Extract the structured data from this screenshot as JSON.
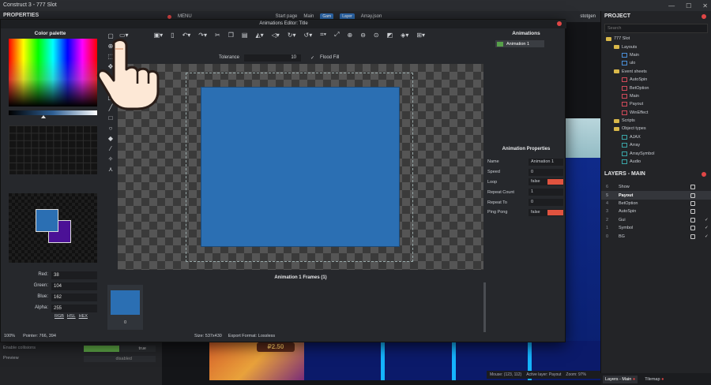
{
  "window": {
    "title": "Construct 3 - 777 Slot"
  },
  "topbar": {
    "menu": "MENU",
    "items": [
      "Start page",
      "Main",
      "Gam",
      "Layer",
      "Array.json"
    ],
    "user": "stotgen"
  },
  "properties": {
    "title": "PROPERTIES",
    "rows": [
      {
        "label": "Enable collisions",
        "value": "true"
      },
      {
        "label": "Preview",
        "value": "disabled"
      }
    ]
  },
  "dialog": {
    "title": "Animations Editor: Title",
    "color_palette": {
      "title": "Color palette",
      "primary": "#2b6fb3",
      "secondary": "#4b1196",
      "rgba": [
        {
          "label": "Red:",
          "value": "38"
        },
        {
          "label": "Green:",
          "value": "104"
        },
        {
          "label": "Blue:",
          "value": "162"
        },
        {
          "label": "Alpha:",
          "value": "255"
        }
      ],
      "modes": [
        "RGB",
        "HSL",
        "HEX"
      ]
    },
    "options": {
      "tolerance_label": "Tolerance",
      "tolerance_value": "10",
      "flood_fill_label": "Flood Fill",
      "flood_fill_checked": "✓"
    },
    "frames": {
      "title": "Animation 1 Frames (1)",
      "items": [
        {
          "index": "0",
          "color": "#2b6fb3"
        }
      ]
    },
    "status": {
      "zoom": "100%",
      "pointer": "Pointer: 766, 394",
      "size": "Size: 537x430",
      "format": "Export Format: Lossless"
    },
    "animations": {
      "title": "Animations",
      "items": [
        {
          "name": "Animation 1",
          "color": "#57a04a"
        }
      ]
    },
    "anim_props": {
      "title": "Animation Properties",
      "rows": [
        {
          "label": "Name",
          "value": "Animation 1"
        },
        {
          "label": "Speed",
          "value": "0"
        },
        {
          "label": "Loop",
          "value": "false"
        },
        {
          "label": "Repeat Count",
          "value": "1"
        },
        {
          "label": "Repeat To",
          "value": "0"
        },
        {
          "label": "Ping Pong",
          "value": "false"
        }
      ]
    }
  },
  "project": {
    "title": "PROJECT",
    "search_placeholder": "Search",
    "tree": [
      {
        "label": "777 Slot",
        "type": "folder",
        "indent": 0
      },
      {
        "label": "Layouts",
        "type": "folder",
        "indent": 1
      },
      {
        "label": "Main",
        "type": "layout",
        "indent": 2
      },
      {
        "label": "ulo",
        "type": "layout",
        "indent": 2
      },
      {
        "label": "Event sheets",
        "type": "folder",
        "indent": 1
      },
      {
        "label": "AutoSpin",
        "type": "event",
        "indent": 2
      },
      {
        "label": "BetOption",
        "type": "event",
        "indent": 2
      },
      {
        "label": "Main",
        "type": "event",
        "indent": 2
      },
      {
        "label": "Payout",
        "type": "event",
        "indent": 2
      },
      {
        "label": "WinEffect",
        "type": "event",
        "indent": 2
      },
      {
        "label": "Scripts",
        "type": "folder",
        "indent": 1
      },
      {
        "label": "Object types",
        "type": "folder",
        "indent": 1
      },
      {
        "label": "AJAX",
        "type": "object",
        "indent": 2
      },
      {
        "label": "Array",
        "type": "object",
        "indent": 2
      },
      {
        "label": "ArraySymbol",
        "type": "object",
        "indent": 2
      },
      {
        "label": "Audio",
        "type": "object",
        "indent": 2
      }
    ]
  },
  "layers": {
    "title": "LAYERS - MAIN",
    "rows": [
      {
        "num": "6",
        "name": "Show",
        "check": ""
      },
      {
        "num": "5",
        "name": "Payout",
        "check": "",
        "selected": true
      },
      {
        "num": "4",
        "name": "BetOption",
        "check": ""
      },
      {
        "num": "3",
        "name": "AutoSpin",
        "check": ""
      },
      {
        "num": "2",
        "name": "Gui",
        "check": "✓"
      },
      {
        "num": "1",
        "name": "Symbol",
        "check": "✓"
      },
      {
        "num": "0",
        "name": "BG",
        "check": "✓"
      }
    ],
    "tabs": [
      "Layers - Main",
      "Tilemap"
    ]
  },
  "layout_status": {
    "mouse": "Mouse: (123, 112)",
    "active_layer": "Active layer: Payout",
    "zoom": "Zoom: 97%"
  },
  "game_text": "₽2.50"
}
